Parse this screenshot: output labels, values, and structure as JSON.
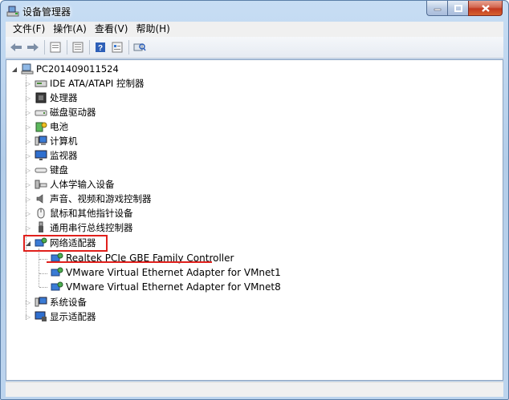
{
  "window": {
    "title": "设备管理器"
  },
  "menu": [
    "文件(F)",
    "操作(A)",
    "查看(V)",
    "帮助(H)"
  ],
  "toolbar": [
    "back-icon",
    "forward-icon",
    "properties-icon",
    "list-icon",
    "help-icon",
    "view-icon",
    "scan-hardware-icon"
  ],
  "tree": {
    "root": "PC201409011524",
    "categories": {
      "ide": "IDE ATA/ATAPI 控制器",
      "cpu": "处理器",
      "disk": "磁盘驱动器",
      "battery": "电池",
      "computer": "计算机",
      "monitor": "监视器",
      "keyboard": "键盘",
      "hid": "人体学输入设备",
      "audio": "声音、视频和游戏控制器",
      "mouse": "鼠标和其他指针设备",
      "usb": "通用串行总线控制器",
      "network": "网络适配器",
      "system": "系统设备",
      "display": "显示适配器"
    },
    "network_devices": [
      "Realtek PCIe GBE Family Controller",
      "VMware Virtual Ethernet Adapter for VMnet1",
      "VMware Virtual Ethernet Adapter for VMnet8"
    ]
  },
  "colors": {
    "highlight": "#e0201c",
    "titlebar": "#c7ddf4"
  }
}
